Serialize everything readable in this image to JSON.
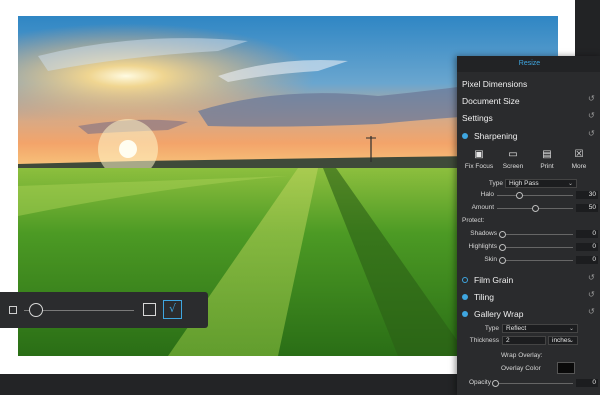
{
  "panel": {
    "header": "Resize",
    "sections": {
      "pixel_dimensions": "Pixel Dimensions",
      "document_size": "Document Size",
      "settings": "Settings",
      "sharpening": "Sharpening",
      "film_grain": "Film Grain",
      "tiling": "Tiling",
      "gallery_wrap": "Gallery Wrap"
    },
    "sharpen_targets": [
      {
        "label": "Fix Focus",
        "icon": "camera-icon"
      },
      {
        "label": "Screen",
        "icon": "monitor-icon"
      },
      {
        "label": "Print",
        "icon": "printer-icon"
      },
      {
        "label": "More",
        "icon": "more-icon"
      }
    ],
    "type_label": "Type",
    "type_value": "High Pass",
    "halo_label": "Halo",
    "halo_value": "30",
    "halo_level": 0.3,
    "amount_label": "Amount",
    "amount_value": "50",
    "amount_level": 0.5,
    "protect_label": "Protect:",
    "shadows_label": "Shadows",
    "shadows_value": "0",
    "highlights_label": "Highlights",
    "highlights_value": "0",
    "skin_label": "Skin",
    "skin_value": "0",
    "wrap_type_label": "Type",
    "wrap_type_value": "Reflect",
    "thickness_label": "Thickness",
    "thickness_value": "2",
    "thickness_unit": "inches",
    "wrap_overlay_label": "Wrap Overlay:",
    "overlay_color_label": "Overlay Color",
    "overlay_color": "#0a0a0a",
    "opacity_label": "Opacity",
    "opacity_value": "0"
  },
  "toolbar": {
    "zoom_level": 0.1
  },
  "colors": {
    "accent": "#3fa6e0",
    "panel_bg": "#2a2b2d",
    "panel_header_bg": "#222325"
  }
}
